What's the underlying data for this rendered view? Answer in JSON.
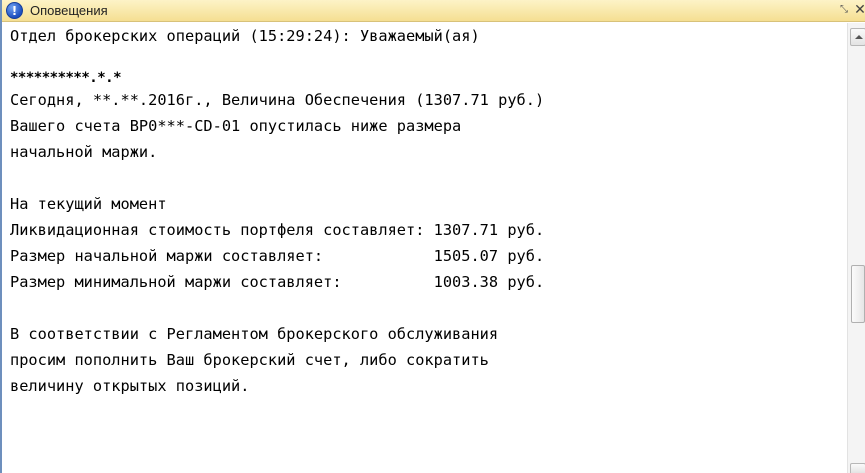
{
  "window": {
    "title": "Оповещения",
    "info_icon_glyph": "!",
    "expand_glyph": "⤡",
    "close_glyph": "✕"
  },
  "message": {
    "line1": "Отдел брокерских операций (15:29:24): Уважаемый(ая)",
    "masked_name": "**********.*.*",
    "line3": "Сегодня, **.**.2016г., Величина Обеспечения (1307.71 руб.)",
    "line4": "Вашего счета BP0***-CD-01 опустилась ниже размера",
    "line5": "начальной маржи.",
    "line6": "",
    "line7": "На текущий момент",
    "line8": "Ликвидационная стоимость портфеля составляет: 1307.71 руб.",
    "line9": "Размер начальной маржи составляет:            1505.07 руб.",
    "line10": "Размер минимальной маржи составляет:          1003.38 руб.",
    "line11": "",
    "line12": "В соответствии с Регламентом брокерского обслуживания",
    "line13": "просим пополнить Ваш брокерский счет, либо сократить",
    "line14": "величину открытых позиций."
  },
  "colors": {
    "titlebar": "#f5df92",
    "accent": "#1c4fc0",
    "text": "#000000"
  }
}
